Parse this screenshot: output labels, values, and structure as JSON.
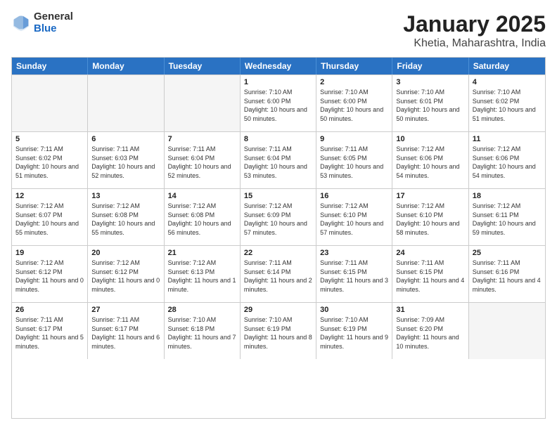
{
  "logo": {
    "general": "General",
    "blue": "Blue"
  },
  "title": "January 2025",
  "subtitle": "Khetia, Maharashtra, India",
  "weekdays": [
    "Sunday",
    "Monday",
    "Tuesday",
    "Wednesday",
    "Thursday",
    "Friday",
    "Saturday"
  ],
  "rows": [
    [
      {
        "day": "",
        "empty": true
      },
      {
        "day": "",
        "empty": true
      },
      {
        "day": "",
        "empty": true
      },
      {
        "day": "1",
        "sunrise": "Sunrise: 7:10 AM",
        "sunset": "Sunset: 6:00 PM",
        "daylight": "Daylight: 10 hours and 50 minutes."
      },
      {
        "day": "2",
        "sunrise": "Sunrise: 7:10 AM",
        "sunset": "Sunset: 6:00 PM",
        "daylight": "Daylight: 10 hours and 50 minutes."
      },
      {
        "day": "3",
        "sunrise": "Sunrise: 7:10 AM",
        "sunset": "Sunset: 6:01 PM",
        "daylight": "Daylight: 10 hours and 50 minutes."
      },
      {
        "day": "4",
        "sunrise": "Sunrise: 7:10 AM",
        "sunset": "Sunset: 6:02 PM",
        "daylight": "Daylight: 10 hours and 51 minutes."
      }
    ],
    [
      {
        "day": "5",
        "sunrise": "Sunrise: 7:11 AM",
        "sunset": "Sunset: 6:02 PM",
        "daylight": "Daylight: 10 hours and 51 minutes."
      },
      {
        "day": "6",
        "sunrise": "Sunrise: 7:11 AM",
        "sunset": "Sunset: 6:03 PM",
        "daylight": "Daylight: 10 hours and 52 minutes."
      },
      {
        "day": "7",
        "sunrise": "Sunrise: 7:11 AM",
        "sunset": "Sunset: 6:04 PM",
        "daylight": "Daylight: 10 hours and 52 minutes."
      },
      {
        "day": "8",
        "sunrise": "Sunrise: 7:11 AM",
        "sunset": "Sunset: 6:04 PM",
        "daylight": "Daylight: 10 hours and 53 minutes."
      },
      {
        "day": "9",
        "sunrise": "Sunrise: 7:11 AM",
        "sunset": "Sunset: 6:05 PM",
        "daylight": "Daylight: 10 hours and 53 minutes."
      },
      {
        "day": "10",
        "sunrise": "Sunrise: 7:12 AM",
        "sunset": "Sunset: 6:06 PM",
        "daylight": "Daylight: 10 hours and 54 minutes."
      },
      {
        "day": "11",
        "sunrise": "Sunrise: 7:12 AM",
        "sunset": "Sunset: 6:06 PM",
        "daylight": "Daylight: 10 hours and 54 minutes."
      }
    ],
    [
      {
        "day": "12",
        "sunrise": "Sunrise: 7:12 AM",
        "sunset": "Sunset: 6:07 PM",
        "daylight": "Daylight: 10 hours and 55 minutes."
      },
      {
        "day": "13",
        "sunrise": "Sunrise: 7:12 AM",
        "sunset": "Sunset: 6:08 PM",
        "daylight": "Daylight: 10 hours and 55 minutes."
      },
      {
        "day": "14",
        "sunrise": "Sunrise: 7:12 AM",
        "sunset": "Sunset: 6:08 PM",
        "daylight": "Daylight: 10 hours and 56 minutes."
      },
      {
        "day": "15",
        "sunrise": "Sunrise: 7:12 AM",
        "sunset": "Sunset: 6:09 PM",
        "daylight": "Daylight: 10 hours and 57 minutes."
      },
      {
        "day": "16",
        "sunrise": "Sunrise: 7:12 AM",
        "sunset": "Sunset: 6:10 PM",
        "daylight": "Daylight: 10 hours and 57 minutes."
      },
      {
        "day": "17",
        "sunrise": "Sunrise: 7:12 AM",
        "sunset": "Sunset: 6:10 PM",
        "daylight": "Daylight: 10 hours and 58 minutes."
      },
      {
        "day": "18",
        "sunrise": "Sunrise: 7:12 AM",
        "sunset": "Sunset: 6:11 PM",
        "daylight": "Daylight: 10 hours and 59 minutes."
      }
    ],
    [
      {
        "day": "19",
        "sunrise": "Sunrise: 7:12 AM",
        "sunset": "Sunset: 6:12 PM",
        "daylight": "Daylight: 11 hours and 0 minutes."
      },
      {
        "day": "20",
        "sunrise": "Sunrise: 7:12 AM",
        "sunset": "Sunset: 6:12 PM",
        "daylight": "Daylight: 11 hours and 0 minutes."
      },
      {
        "day": "21",
        "sunrise": "Sunrise: 7:12 AM",
        "sunset": "Sunset: 6:13 PM",
        "daylight": "Daylight: 11 hours and 1 minute."
      },
      {
        "day": "22",
        "sunrise": "Sunrise: 7:11 AM",
        "sunset": "Sunset: 6:14 PM",
        "daylight": "Daylight: 11 hours and 2 minutes."
      },
      {
        "day": "23",
        "sunrise": "Sunrise: 7:11 AM",
        "sunset": "Sunset: 6:15 PM",
        "daylight": "Daylight: 11 hours and 3 minutes."
      },
      {
        "day": "24",
        "sunrise": "Sunrise: 7:11 AM",
        "sunset": "Sunset: 6:15 PM",
        "daylight": "Daylight: 11 hours and 4 minutes."
      },
      {
        "day": "25",
        "sunrise": "Sunrise: 7:11 AM",
        "sunset": "Sunset: 6:16 PM",
        "daylight": "Daylight: 11 hours and 4 minutes."
      }
    ],
    [
      {
        "day": "26",
        "sunrise": "Sunrise: 7:11 AM",
        "sunset": "Sunset: 6:17 PM",
        "daylight": "Daylight: 11 hours and 5 minutes."
      },
      {
        "day": "27",
        "sunrise": "Sunrise: 7:11 AM",
        "sunset": "Sunset: 6:17 PM",
        "daylight": "Daylight: 11 hours and 6 minutes."
      },
      {
        "day": "28",
        "sunrise": "Sunrise: 7:10 AM",
        "sunset": "Sunset: 6:18 PM",
        "daylight": "Daylight: 11 hours and 7 minutes."
      },
      {
        "day": "29",
        "sunrise": "Sunrise: 7:10 AM",
        "sunset": "Sunset: 6:19 PM",
        "daylight": "Daylight: 11 hours and 8 minutes."
      },
      {
        "day": "30",
        "sunrise": "Sunrise: 7:10 AM",
        "sunset": "Sunset: 6:19 PM",
        "daylight": "Daylight: 11 hours and 9 minutes."
      },
      {
        "day": "31",
        "sunrise": "Sunrise: 7:09 AM",
        "sunset": "Sunset: 6:20 PM",
        "daylight": "Daylight: 11 hours and 10 minutes."
      },
      {
        "day": "",
        "empty": true
      }
    ]
  ]
}
